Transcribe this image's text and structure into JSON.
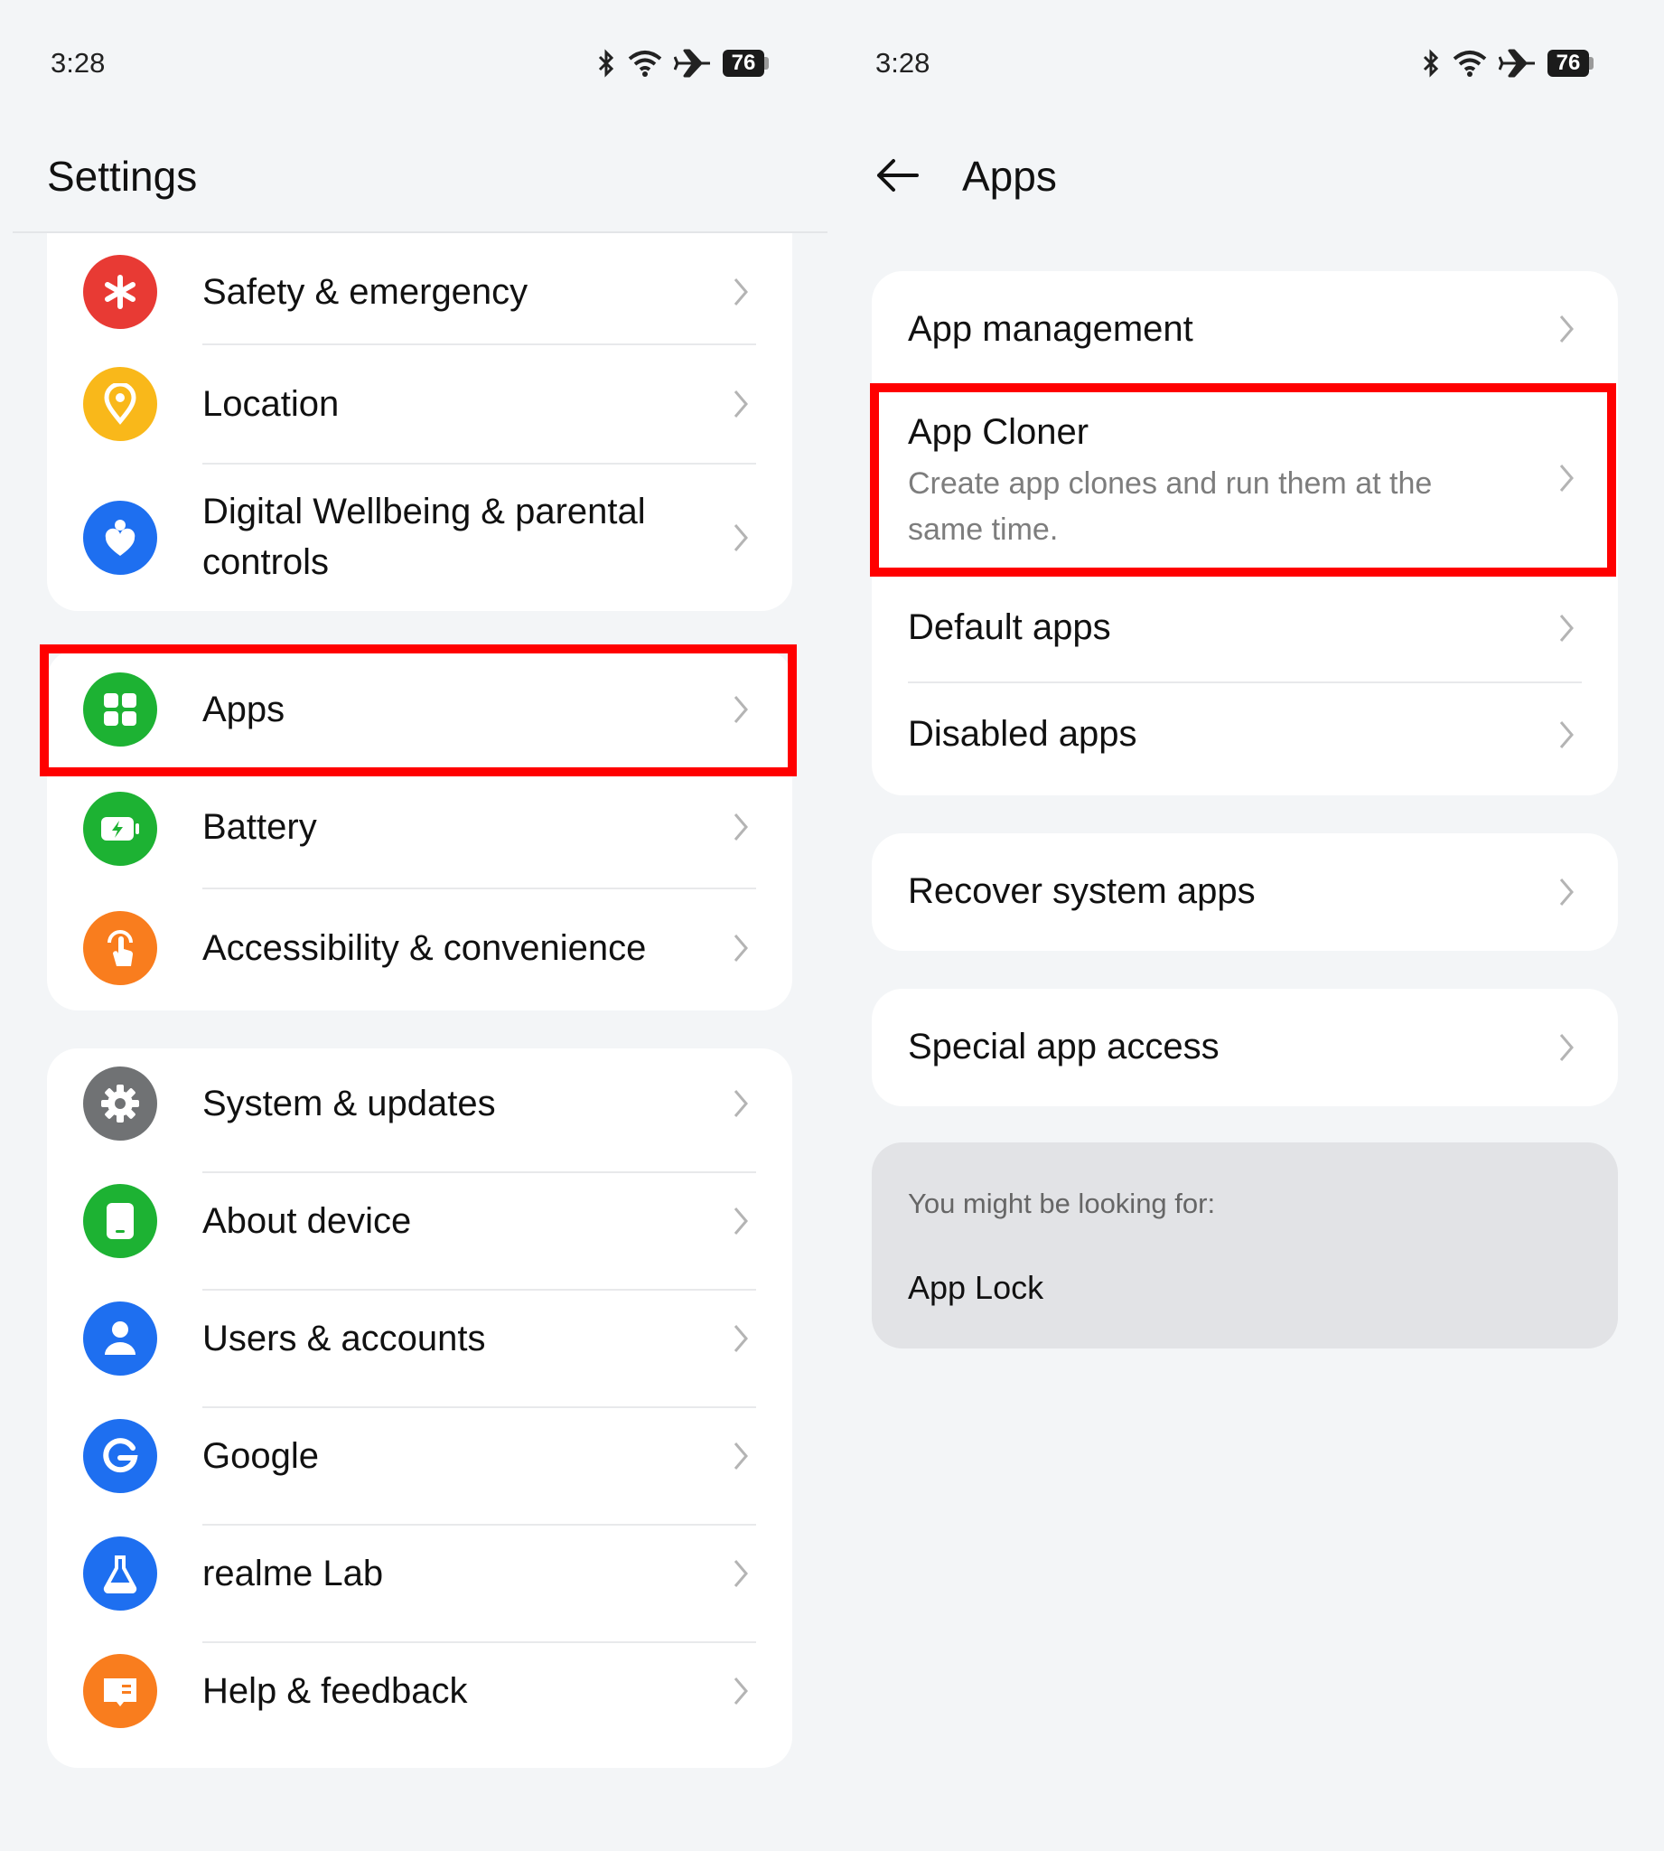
{
  "status": {
    "time": "3:28",
    "battery": "76"
  },
  "left": {
    "title": "Settings",
    "group1": [
      {
        "label": "Safety & emergency",
        "icon": "asterisk-icon",
        "color": "#e83a34"
      },
      {
        "label": "Location",
        "icon": "location-pin-icon",
        "color": "#f9b81a"
      },
      {
        "label": "Digital Wellbeing & parental controls",
        "label_line1": "Digital Wellbeing & parental",
        "label_line2": "controls",
        "icon": "heart-person-icon",
        "color": "#1e6ff0"
      }
    ],
    "group2": [
      {
        "label": "Apps",
        "icon": "apps-grid-icon",
        "color": "#1db233"
      },
      {
        "label": "Battery",
        "icon": "battery-charging-icon",
        "color": "#1db233"
      },
      {
        "label": "Accessibility & convenience",
        "icon": "tap-hand-icon",
        "color": "#f97d1e"
      }
    ],
    "group3": [
      {
        "label": "System & updates",
        "icon": "gear-icon",
        "color": "#707274"
      },
      {
        "label": "About device",
        "icon": "phone-device-icon",
        "color": "#1db233"
      },
      {
        "label": "Users & accounts",
        "icon": "user-icon",
        "color": "#1e6ff0"
      },
      {
        "label": "Google",
        "icon": "google-g-icon",
        "color": "#1e6ff0"
      },
      {
        "label": "realme Lab",
        "icon": "flask-icon",
        "color": "#1e6ff0"
      },
      {
        "label": "Help & feedback",
        "icon": "feedback-book-icon",
        "color": "#f97d1e"
      }
    ]
  },
  "right": {
    "title": "Apps",
    "card1": [
      {
        "label": "App management"
      },
      {
        "label": "App Cloner",
        "sub_line1": "Create app clones and run them at the",
        "sub_line2": "same time."
      },
      {
        "label": "Default apps"
      },
      {
        "label": "Disabled apps"
      }
    ],
    "card2": {
      "label": "Recover system apps"
    },
    "card3": {
      "label": "Special app access"
    },
    "suggest": {
      "heading": "You might be looking for:",
      "item": "App Lock"
    }
  },
  "colors": {
    "highlight": "#ff0000",
    "background": "#f3f5f7"
  }
}
